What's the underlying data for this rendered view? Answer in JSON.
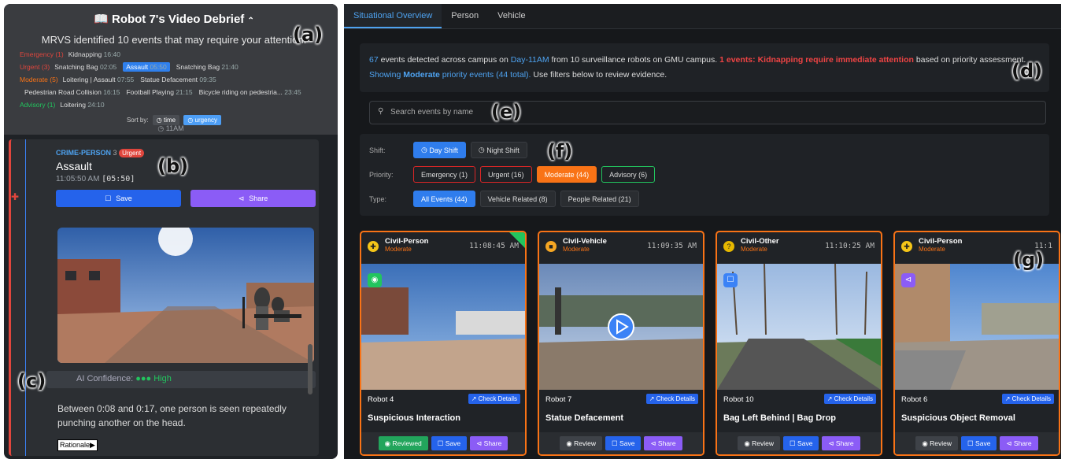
{
  "left": {
    "title": "Robot 7's Video Debrief",
    "subtitle": "MRVS identified 10 events that may require your attention.",
    "rows": [
      {
        "label": "Emergency (1)",
        "color": "#e0463d",
        "items": [
          {
            "name": "Kidnapping",
            "t": "16:40"
          }
        ]
      },
      {
        "label": "Urgent (3)",
        "color": "#e0463d",
        "items": [
          {
            "name": "Snatching Bag",
            "t": "02:05"
          },
          {
            "name": "Assault",
            "t": "05:50"
          },
          {
            "name": "Snatching Bag",
            "t": "21:40"
          }
        ]
      },
      {
        "label": "Moderate (5)",
        "color": "#f97316",
        "items": [
          {
            "name": "Loitering | Assault",
            "t": "07:55"
          },
          {
            "name": "Statue Defacement",
            "t": "09:35"
          }
        ]
      },
      {
        "label": "",
        "color": "#ddd",
        "items": [
          {
            "name": "Pedestrian Road Collision",
            "t": "16:15"
          },
          {
            "name": "Football Playing",
            "t": "21:15"
          },
          {
            "name": "Bicycle riding on pedestria...",
            "t": "23:45"
          }
        ]
      },
      {
        "label": "Advisory (1)",
        "color": "#22c55e",
        "items": [
          {
            "name": "Loitering",
            "t": "24:10"
          }
        ]
      }
    ],
    "sort_label": "Sort by:",
    "sort_time": "time",
    "sort_urgency": "urgency",
    "hour": "11AM",
    "card": {
      "tag": "CRIME-PERSON",
      "count": "3",
      "badge": "Urgent",
      "title": "Assault",
      "time": "11:05:50 AM",
      "ts": "[05:50]",
      "save": "Save",
      "share": "Share",
      "confidence_label": "AI Confidence:",
      "confidence": "High",
      "description": "Between 0:08 and 0:17, one person is seen repeatedly punching another on the head.",
      "rationale": "Rationale▶"
    }
  },
  "tabs": [
    "Situational Overview",
    "Person",
    "Vehicle"
  ],
  "summary": {
    "count": "67",
    "a": " events detected across campus on ",
    "day": "Day-11AM",
    "b": " from 10 surveillance robots on GMU campus. ",
    "alert": "1 events: Kidnapping require immediate attention",
    "c": " based on priority assessment. ",
    "show": "Showing ",
    "level": "Moderate",
    "d": " priority events (44 total).",
    "e": " Use filters below to review evidence."
  },
  "search_placeholder": "Search events by name",
  "filters": {
    "shift_label": "Shift:",
    "day": "Day Shift",
    "night": "Night Shift",
    "priority_label": "Priority:",
    "emergency": "Emergency (1)",
    "urgent": "Urgent (16)",
    "moderate": "Moderate (44)",
    "advisory": "Advisory (6)",
    "type_label": "Type:",
    "all": "All Events (44)",
    "vehicle": "Vehicle Related (8)",
    "people": "People Related (21)"
  },
  "events": [
    {
      "cat": "Civil-Person",
      "level": "Moderate",
      "time": "11:08:45 AM",
      "robot": "Robot 4",
      "title": "Suspicious Interaction",
      "review": "Reviewed",
      "save": "Save",
      "share": "Share",
      "details": "Check Details"
    },
    {
      "cat": "Civil-Vehicle",
      "level": "Moderate",
      "time": "11:09:35 AM",
      "robot": "Robot 7",
      "title": "Statue Defacement",
      "review": "Review",
      "save": "Save",
      "share": "Share",
      "details": "Check Details"
    },
    {
      "cat": "Civil-Other",
      "level": "Moderate",
      "time": "11:10:25 AM",
      "robot": "Robot 10",
      "title": "Bag Left Behind | Bag Drop",
      "review": "Review",
      "save": "Save",
      "share": "Share",
      "details": "Check Details"
    },
    {
      "cat": "Civil-Person",
      "level": "Moderate",
      "time": "11:1",
      "robot": "Robot 6",
      "title": "Suspicious Object Removal",
      "review": "Review",
      "save": "Save",
      "share": "Share",
      "details": "Check Details"
    }
  ],
  "labels": {
    "a": "(a)",
    "b": "(b)",
    "c": "(c)",
    "d": "(d)",
    "e": "(e)",
    "f": "(f)",
    "g": "(g)"
  }
}
